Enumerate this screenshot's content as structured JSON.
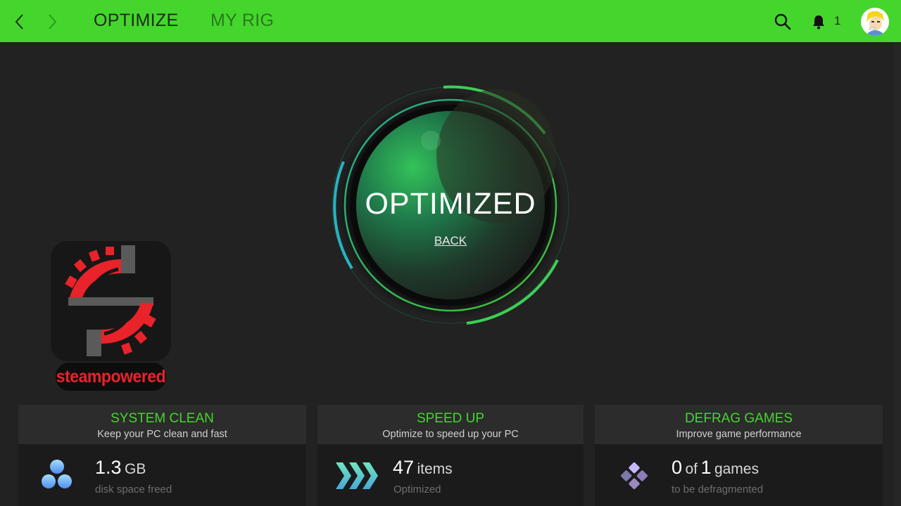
{
  "header": {
    "back_icon": "chevron-left-icon",
    "forward_icon": "chevron-right-icon",
    "tabs": [
      {
        "label": "OPTIMIZE",
        "active": true
      },
      {
        "label": "MY RIG",
        "active": false
      }
    ],
    "search_icon": "search-icon",
    "bell_icon": "bell-icon",
    "notification_count": "1",
    "accent_color": "#44d62c"
  },
  "status": {
    "title": "OPTIMIZED",
    "back_label": "BACK"
  },
  "watermark": {
    "label": "steampowered"
  },
  "cards": [
    {
      "title": "SYSTEM CLEAN",
      "subtitle": "Keep your PC clean and fast",
      "value": "1.3",
      "unit": "GB",
      "label": "disk space freed",
      "icon": "bubbles-icon"
    },
    {
      "title": "SPEED UP",
      "subtitle": "Optimize to speed up your PC",
      "value": "47",
      "unit": "items",
      "label": "Optimized",
      "icon": "chevrons-icon"
    },
    {
      "title": "DEFRAG GAMES",
      "subtitle": "Improve game performance",
      "value": "0",
      "of": "of",
      "total": "1",
      "unit": "games",
      "label": "to be defragmented",
      "icon": "defrag-diamond-icon"
    }
  ]
}
